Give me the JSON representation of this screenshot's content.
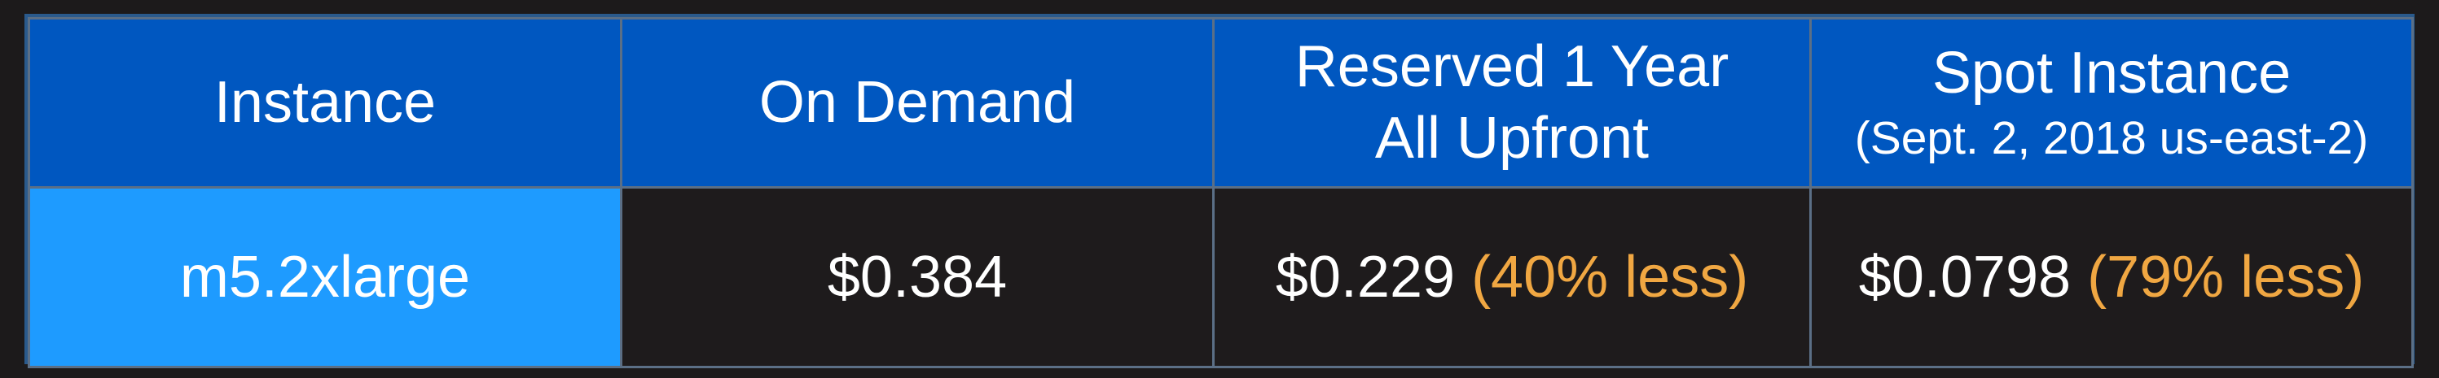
{
  "table": {
    "headers": {
      "instance": "Instance",
      "on_demand": "On Demand",
      "reserved_line1": "Reserved 1 Year",
      "reserved_line2": "All Upfront",
      "spot_line1": "Spot Instance",
      "spot_line2": "(Sept. 2, 2018 us-east-2)"
    },
    "row": {
      "instance": "m5.2xlarge",
      "on_demand": "$0.384",
      "reserved_price": "$0.229",
      "reserved_note": "(40% less)",
      "spot_price": "$0.0798",
      "spot_note": "(79% less)"
    }
  },
  "colors": {
    "header_bg": "#0057c0",
    "instance_cell_bg": "#1e9bff",
    "body_bg": "#1e1b1c",
    "savings_text": "#f0a742",
    "text": "#ffffff"
  }
}
